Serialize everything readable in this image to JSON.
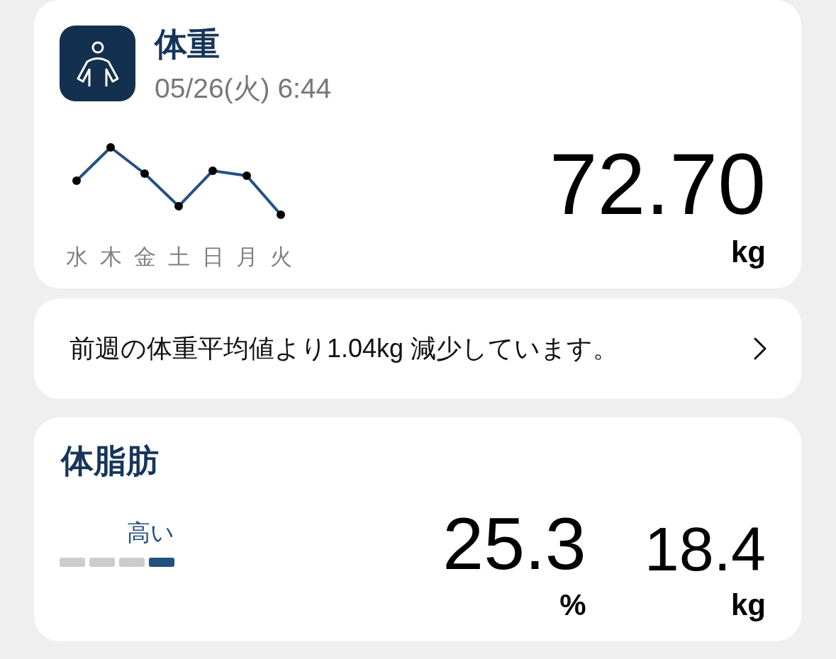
{
  "weight_card": {
    "title": "体重",
    "timestamp": "05/26(火) 6:44",
    "days": [
      "水",
      "木",
      "金",
      "土",
      "日",
      "月",
      "火"
    ],
    "value": "72.70",
    "unit": "kg"
  },
  "notice": {
    "text": "前週の体重平均値より1.04kg 減少しています。"
  },
  "body_fat_card": {
    "title": "体脂肪",
    "rating": "高い",
    "segments": [
      {
        "active": false
      },
      {
        "active": false
      },
      {
        "active": false
      },
      {
        "active": true
      }
    ],
    "readings": [
      {
        "kind": "primary",
        "value": "25.3",
        "unit": "%"
      },
      {
        "kind": "secondary",
        "value": "18.4",
        "unit": "kg"
      }
    ]
  }
}
